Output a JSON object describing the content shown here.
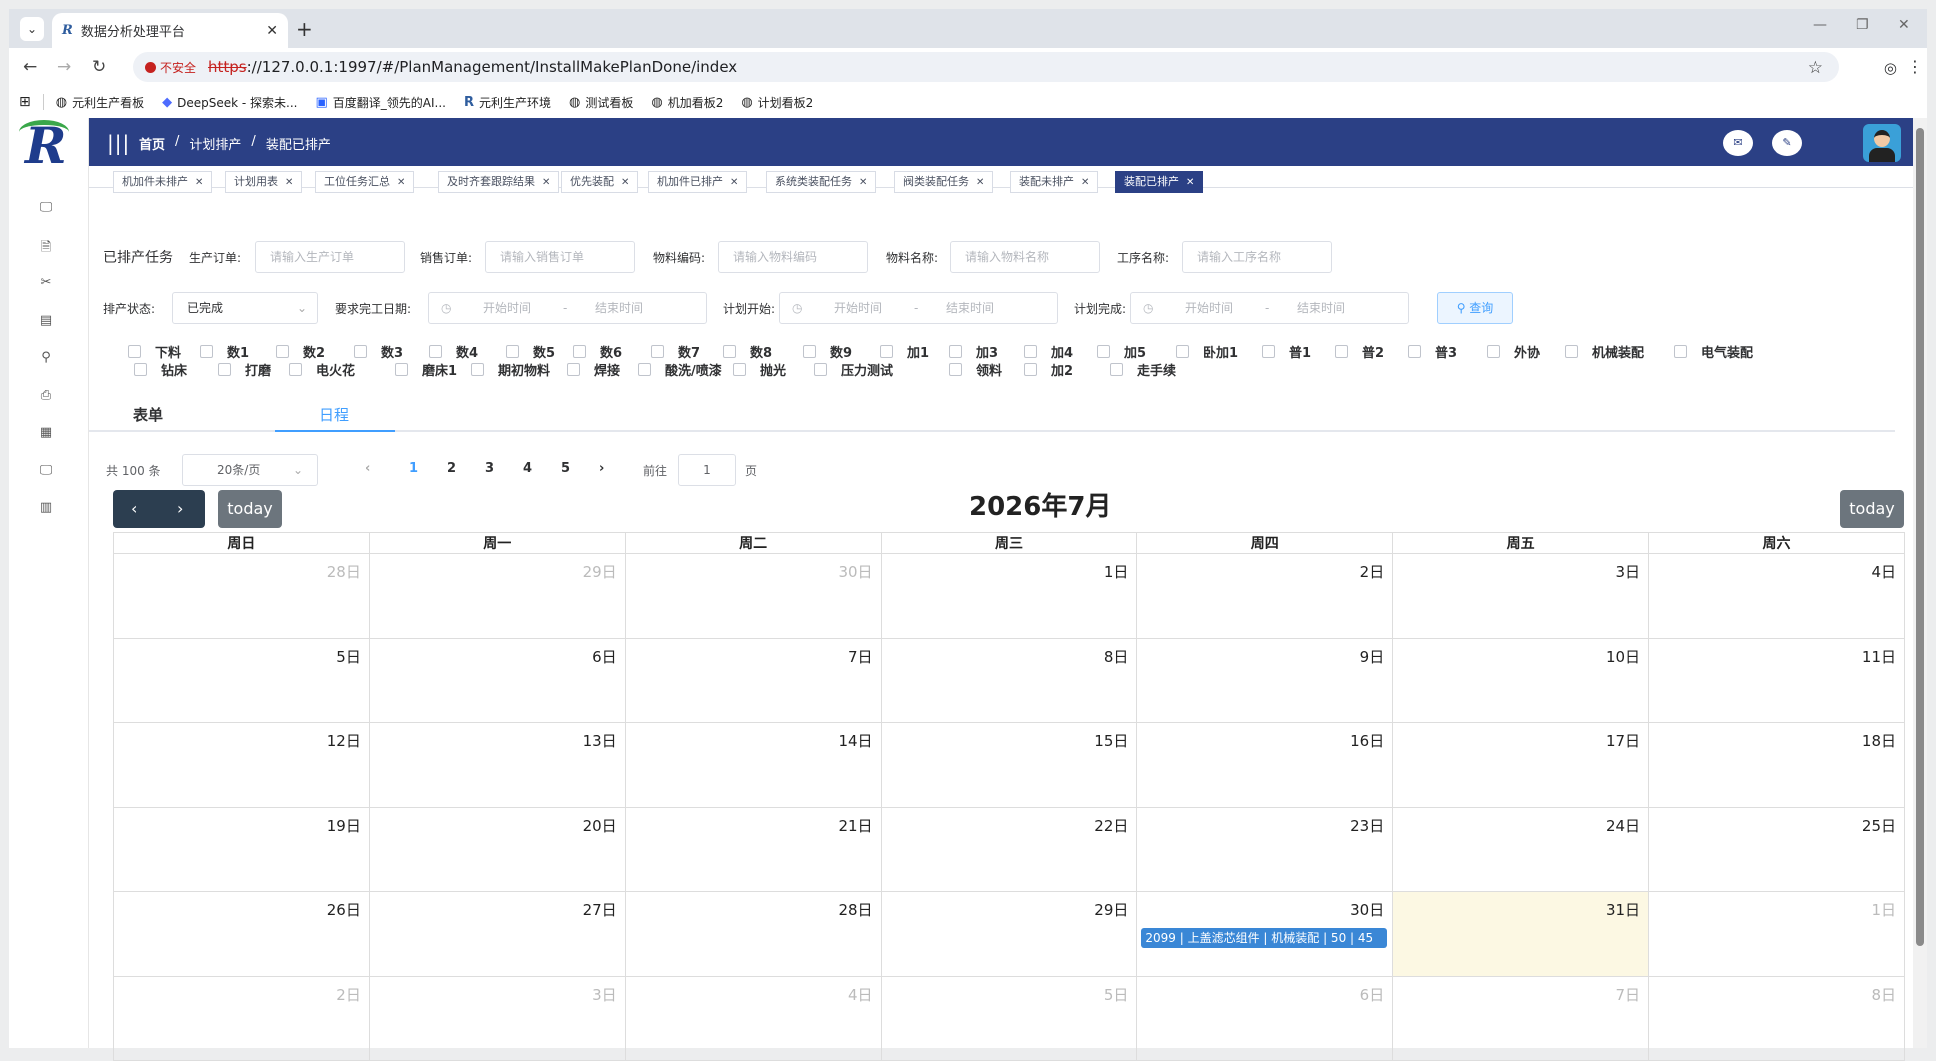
{
  "browser": {
    "tab_title": "数据分析处理平台",
    "tab_favicon": "R",
    "new_tab": "+",
    "url_scheme": "https",
    "url_rest": "://127.0.0.1:1997/#/PlanManagement/InstallMakePlanDone/index",
    "insecure_label": "不安全",
    "bookmarks": [
      "元利生产看板",
      "DeepSeek - 探索未...",
      "百度翻译_领先的AI...",
      "元利生产环境",
      "测试看板",
      "机加看板2",
      "计划看板2"
    ]
  },
  "header": {
    "breadcrumb": [
      "首页",
      "计划排产",
      "装配已排产"
    ]
  },
  "tags": [
    {
      "label": "机加件未排产"
    },
    {
      "label": "计划用表"
    },
    {
      "label": "工位任务汇总"
    },
    {
      "label": "及时齐套跟踪结果"
    },
    {
      "label": "优先装配"
    },
    {
      "label": "机加件已排产"
    },
    {
      "label": "系统类装配任务"
    },
    {
      "label": "阀类装配任务"
    },
    {
      "label": "装配未排产"
    },
    {
      "label": "装配已排产",
      "active": true
    }
  ],
  "filters": {
    "title": "已排产任务",
    "prod_order_label": "生产订单:",
    "prod_order_placeholder": "请输入生产订单",
    "sales_order_label": "销售订单:",
    "sales_order_placeholder": "请输入销售订单",
    "material_code_label": "物料编码:",
    "material_code_placeholder": "请输入物料编码",
    "material_name_label": "物料名称:",
    "material_name_placeholder": "请输入物料名称",
    "process_name_label": "工序名称:",
    "process_name_placeholder": "请输入工序名称",
    "status_label": "排产状态:",
    "status_value": "已完成",
    "due_label": "要求完工日期:",
    "plan_start_label": "计划开始:",
    "plan_end_label": "计划完成:",
    "range_start": "开始时间",
    "range_sep": "-",
    "range_end": "结束时间",
    "query_button": "查询"
  },
  "processes_row1": [
    "下料",
    "数1",
    "数2",
    "数3",
    "数4",
    "数5",
    "数6",
    "数7",
    "数8",
    "数9",
    "加1",
    "加3",
    "加4",
    "加5",
    "卧加1",
    "普1",
    "普2",
    "普3",
    "外协",
    "机械装配",
    "电气装配"
  ],
  "processes_row2": [
    "钻床",
    "打磨",
    "电火花",
    "磨床1",
    "期初物料",
    "焊接",
    "酸洗/喷漆",
    "抛光",
    "压力测试",
    "领料",
    "加2",
    "走手续"
  ],
  "view_tabs": {
    "form": "表单",
    "schedule": "日程"
  },
  "pagination": {
    "total": "共 100 条",
    "page_size": "20条/页",
    "pages": [
      "1",
      "2",
      "3",
      "4",
      "5"
    ],
    "current": "1",
    "goto_label": "前往",
    "goto_value": "1",
    "page_suffix": "页"
  },
  "calendar": {
    "title": "2026年7月",
    "today_label": "today",
    "weekdays": [
      "周日",
      "周一",
      "周二",
      "周三",
      "周四",
      "周五",
      "周六"
    ],
    "weeks": [
      [
        {
          "d": "28日",
          "o": true
        },
        {
          "d": "29日",
          "o": true
        },
        {
          "d": "30日",
          "o": true
        },
        {
          "d": "1日"
        },
        {
          "d": "2日"
        },
        {
          "d": "3日"
        },
        {
          "d": "4日"
        }
      ],
      [
        {
          "d": "5日"
        },
        {
          "d": "6日"
        },
        {
          "d": "7日"
        },
        {
          "d": "8日"
        },
        {
          "d": "9日"
        },
        {
          "d": "10日"
        },
        {
          "d": "11日"
        }
      ],
      [
        {
          "d": "12日"
        },
        {
          "d": "13日"
        },
        {
          "d": "14日"
        },
        {
          "d": "15日"
        },
        {
          "d": "16日"
        },
        {
          "d": "17日"
        },
        {
          "d": "18日"
        }
      ],
      [
        {
          "d": "19日"
        },
        {
          "d": "20日"
        },
        {
          "d": "21日"
        },
        {
          "d": "22日"
        },
        {
          "d": "23日"
        },
        {
          "d": "24日"
        },
        {
          "d": "25日"
        }
      ],
      [
        {
          "d": "26日"
        },
        {
          "d": "27日"
        },
        {
          "d": "28日"
        },
        {
          "d": "29日"
        },
        {
          "d": "30日",
          "event": "2099 | 上盖滤芯组件 | 机械装配 | 50 | 45"
        },
        {
          "d": "31日",
          "today": true
        },
        {
          "d": "1日",
          "o": true
        }
      ],
      [
        {
          "d": "2日",
          "o": true
        },
        {
          "d": "3日",
          "o": true
        },
        {
          "d": "4日",
          "o": true
        },
        {
          "d": "5日",
          "o": true
        },
        {
          "d": "6日",
          "o": true
        },
        {
          "d": "7日",
          "o": true
        },
        {
          "d": "8日",
          "o": true
        }
      ]
    ]
  },
  "colors": {
    "header": "#2b4085",
    "accent": "#409eff",
    "event": "#3a87d6",
    "today_bg": "#fcf8e3"
  }
}
